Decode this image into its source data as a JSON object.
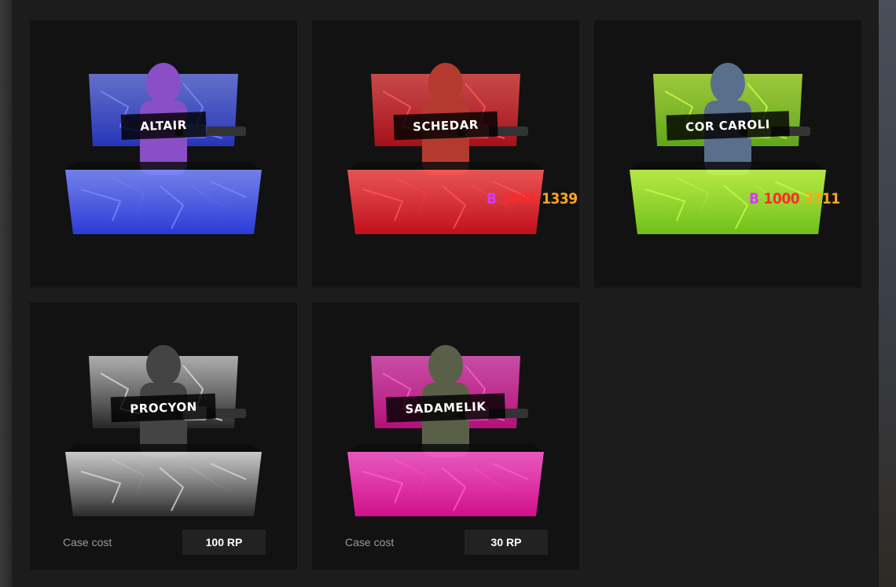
{
  "cases": [
    {
      "name": "ALTAIR",
      "color": "#2a3bd6",
      "accent": "#7c8cff",
      "figure": "#8a4fc7"
    },
    {
      "name": "SCHEDAR",
      "color": "#c0101c",
      "accent": "#ff5a5a",
      "figure": "#b43a30",
      "price": {
        "prefix": "B",
        "old": "1000",
        "new": "1339"
      }
    },
    {
      "name": "COR CAROLI",
      "color": "#6fbf1a",
      "accent": "#c8ff4a",
      "figure": "#5a6f8c",
      "price": {
        "prefix": "B",
        "old": "1000",
        "new": "3711"
      }
    },
    {
      "name": "PROCYON",
      "color": "#2a2a2a",
      "accent": "#dcdcdc",
      "figure": "#444444",
      "cost_label": "Case cost",
      "cost_value": "100 RP"
    },
    {
      "name": "SADAMELIK",
      "color": "#d0108a",
      "accent": "#ff5fd0",
      "figure": "#5a6048",
      "cost_label": "Case cost",
      "cost_value": "30 RP"
    }
  ]
}
